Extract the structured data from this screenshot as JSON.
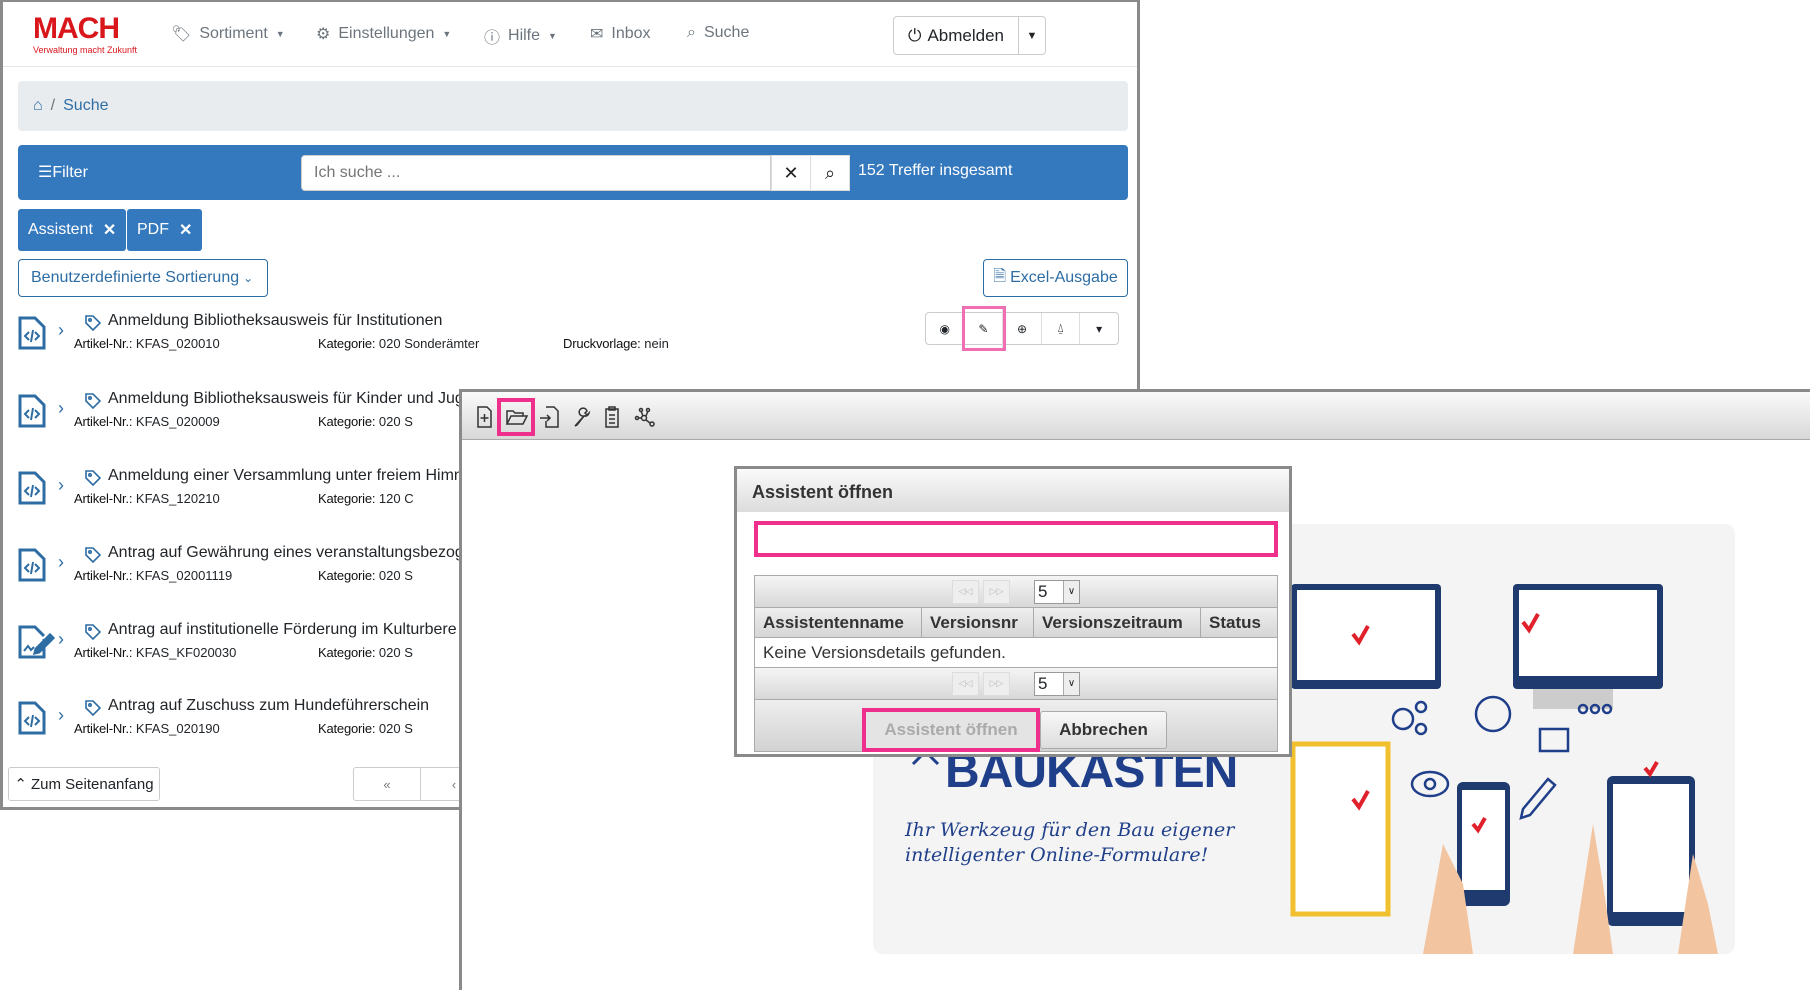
{
  "brand": {
    "logo": "MACH",
    "tagline": "Verwaltung macht Zukunft",
    "accent": "#3478bd",
    "highlight": "#ef2f8c"
  },
  "nav": {
    "items": [
      {
        "label": "Sortiment",
        "icon": "tag-icon",
        "dropdown": true
      },
      {
        "label": "Einstellungen",
        "icon": "gear-icon",
        "dropdown": true
      },
      {
        "label": "Hilfe",
        "icon": "question-icon",
        "dropdown": true
      },
      {
        "label": "Inbox",
        "icon": "mail-icon"
      },
      {
        "label": "Suche",
        "icon": "search-icon"
      }
    ],
    "logout": "Abmelden"
  },
  "breadcrumb": {
    "sep": "/",
    "current": "Suche"
  },
  "searchbar": {
    "filter": "Filter",
    "placeholder": "Ich suche ...",
    "clear": "✕",
    "results": "152 Treffer insgesamt"
  },
  "tags": [
    {
      "label": "Assistent"
    },
    {
      "label": "PDF"
    }
  ],
  "sort": "Benutzerdefinierte Sortierung",
  "excel": "Excel-Ausgabe",
  "labels": {
    "artnr": "Artikel-Nr.:",
    "kat": "Kategorie:",
    "druck": "Druckvorlage:"
  },
  "results": [
    {
      "title": "Anmeldung Bibliotheksausweis für Institutionen",
      "artnr": "KFAS_020010",
      "kat": "020 Sonderämter",
      "druck": "nein",
      "icon": "code-file-icon"
    },
    {
      "title": "Anmeldung Bibliotheksausweis für Kinder und Jug",
      "artnr": "KFAS_020009",
      "kat": "020 S",
      "icon": "code-file-icon"
    },
    {
      "title": "Anmeldung einer Versammlung unter freiem Himn",
      "artnr": "KFAS_120210",
      "kat": "120 C",
      "icon": "code-file-icon"
    },
    {
      "title": "Antrag auf Gewährung eines veranstaltungsbezog",
      "artnr": "KFAS_02001119",
      "kat": "020 S",
      "icon": "code-file-icon"
    },
    {
      "title": "Antrag auf institutionelle Förderung im Kulturbere",
      "artnr": "KFAS_KF020030",
      "kat": "020 S",
      "icon": "signature-file-icon"
    },
    {
      "title": "Antrag auf Zuschuss zum Hundeführerschein",
      "artnr": "KFAS_020190",
      "kat": "020 S",
      "icon": "code-file-icon"
    }
  ],
  "actions": [
    "eye-icon",
    "pencil-icon",
    "globe-icon",
    "stamp-icon",
    "caret-icon"
  ],
  "footer": {
    "top": "Zum Seitenanfang",
    "pages": [
      "«",
      "‹"
    ]
  },
  "editor": {
    "toolbar": [
      "new-file-icon",
      "open-folder-icon",
      "import-icon",
      "wrench-icon",
      "clipboard-icon",
      "graph-icon"
    ]
  },
  "dialog": {
    "title": "Assistent öffnen",
    "input_value": "",
    "page_size": "5",
    "columns": [
      "Assistentenname",
      "Versionsnr",
      "Versionszeitraum",
      "Status"
    ],
    "empty": "Keine Versionsdetails gefunden.",
    "open": "Assistent öffnen",
    "cancel": "Abbrechen"
  },
  "promo": {
    "title": "BAUKASTEN",
    "line1": "Ihr Werkzeug für den Bau eigener",
    "line2": "intelligenter Online-Formulare!"
  }
}
